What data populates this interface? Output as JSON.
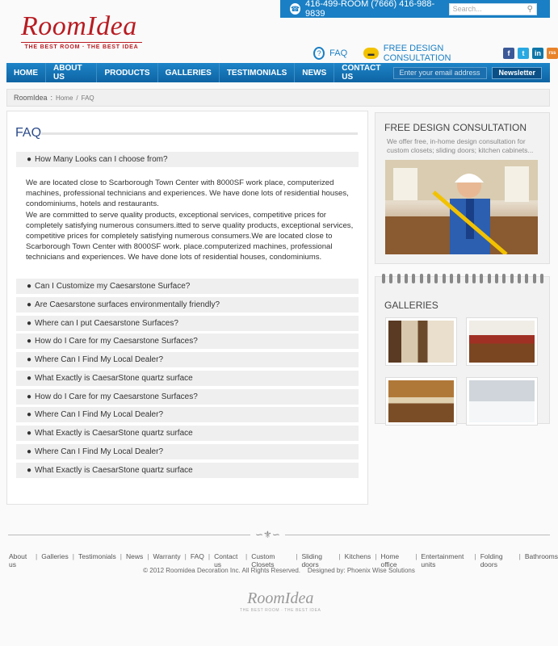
{
  "topbar": {
    "phone_label": "416-499-ROOM (7666)  416-988-9839",
    "search_placeholder": "Search..."
  },
  "logo": {
    "name": "RoomIdea",
    "tagline": "THE BEST ROOM · THE BEST IDEA"
  },
  "header_links": {
    "faq": "FAQ",
    "consultation": "FREE DESIGN CONSULTATION",
    "social": [
      "f",
      "t",
      "in",
      "rss"
    ]
  },
  "nav": {
    "items": [
      "HOME",
      "ABOUT US",
      "PRODUCTS",
      "GALLERIES",
      "TESTIMONIALS",
      "NEWS",
      "CONTACT US"
    ],
    "email_placeholder": "Enter your email address",
    "newsletter_button": "Newsletter"
  },
  "breadcrumb": {
    "site": "RoomIdea",
    "sep": ":",
    "home": "Home",
    "slash": "/",
    "current": "FAQ"
  },
  "main": {
    "title": "FAQ",
    "first_question": "How Many Looks can I choose from?",
    "answer": "We are located close to Scarborough Town Center with 8000SF work place, computerized machines, professional technicians and experiences. We have done lots of residential houses, condominiums, hotels and restaurants.\nWe are committed to serve quality products, exceptional services, competitive prices for completely satisfying numerous consumers.itted to serve quality products, exceptional services, competitive prices for completely satisfying numerous consumers.We are located close to Scarborough Town Center with 8000SF work. place.computerized machines, professional technicians and experiences. We have done lots of residential houses, condominiums.",
    "questions": [
      "Can I Customize my Caesarstone Surface?",
      "Are Caesarstone surfaces environmentally friendly?",
      "Where can I put Caesarstone Surfaces?",
      "How do I Care for my Caesarstone Surfaces?",
      "Where Can I Find My Local Dealer?",
      "What Exactly is CaesarStone quartz surface",
      "How do I Care for my Caesarstone Surfaces?",
      "Where Can I Find My Local Dealer?",
      "What Exactly is CaesarStone quartz surface",
      "Where Can I Find My Local Dealer?",
      "What Exactly is CaesarStone quartz surface"
    ]
  },
  "sidebar": {
    "consult_title": "FREE DESIGN CONSULTATION",
    "consult_text": "We offer free, in-home design consultation for custom closets; sliding doors; kitchen cabinets...",
    "galleries_title": "GALLERIES"
  },
  "footer": {
    "links": [
      "About us",
      "Galleries",
      "Testimonials",
      "News",
      "Warranty",
      "FAQ",
      "Contact us",
      "Custom Closets",
      "Sliding doors",
      "Kitchens",
      "Home office",
      "Entertainment units",
      "Folding doors",
      "Bathrooms"
    ],
    "copyright": "© 2012 Roomidea Decoration Inc. All Rights Reserved.    Designed by: Phoenix Wise Solutions",
    "logo_name": "RoomIdea",
    "logo_tag": "THE BEST ROOM · THE BEST IDEA"
  }
}
